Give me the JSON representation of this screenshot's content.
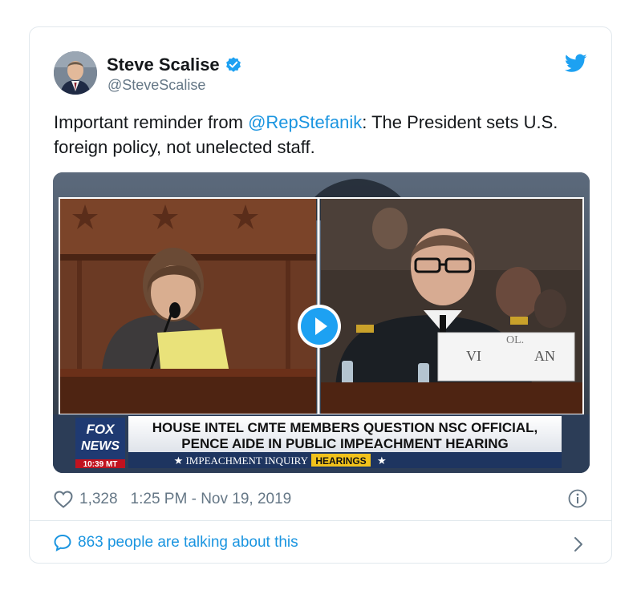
{
  "tweet": {
    "author_name": "Steve Scalise",
    "author_handle": "@SteveScalise",
    "text_prefix": "Important reminder from ",
    "mention": "@RepStefanik",
    "text_suffix": ": The President sets U.S. foreign policy, not unelected staff.",
    "likes": "1,328",
    "timestamp": "1:25 PM - Nov 19, 2019",
    "talking": "863 people are talking about this"
  },
  "media": {
    "headline_line1": "HOUSE INTEL CMTE MEMBERS QUESTION NSC OFFICIAL,",
    "headline_line2": "PENCE AIDE IN PUBLIC IMPEACHMENT HEARING",
    "ticker_left": "★ IMPEACHMENT INQUIRY",
    "ticker_badge": "HEARINGS",
    "ticker_right": "★",
    "logo_line1": "FOX",
    "logo_line2": "NEWS",
    "clock": "10:39 MT",
    "nameplate_left": "VI",
    "nameplate_right": "AN",
    "nameplate_top": "OL."
  },
  "colors": {
    "brand_blue": "#1da1f2",
    "link_blue": "#1b95e0",
    "secondary_text": "#657786",
    "border": "#e1e8ed"
  },
  "icons": [
    "verified-badge-icon",
    "twitter-bird-icon",
    "play-icon",
    "heart-icon",
    "info-icon",
    "speech-bubble-icon",
    "chevron-right-icon"
  ]
}
